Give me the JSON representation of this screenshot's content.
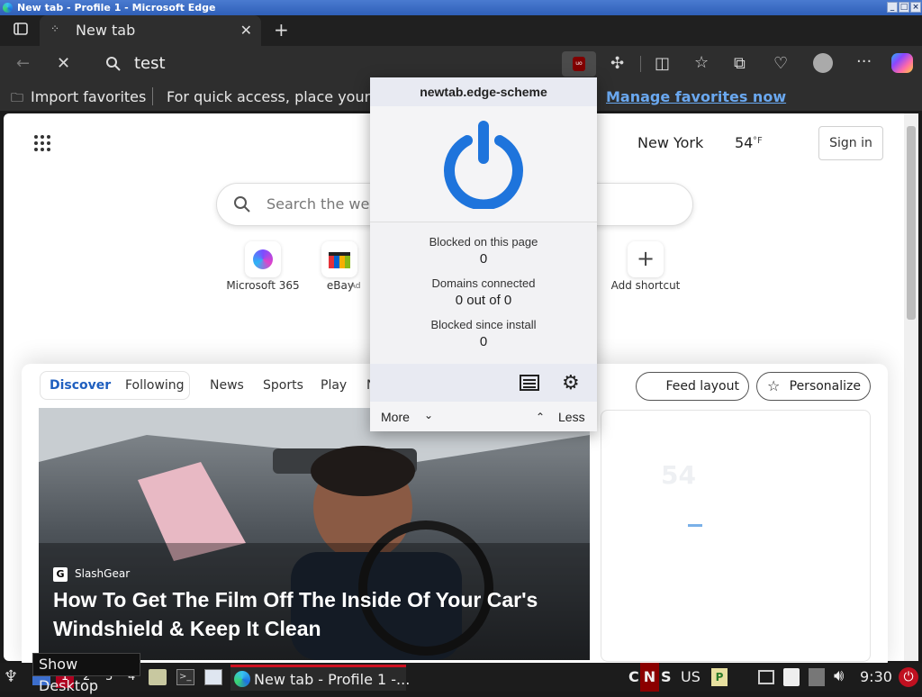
{
  "window": {
    "title": "New tab - Profile 1 - Microsoft Edge"
  },
  "tab": {
    "title": "New tab"
  },
  "address_bar": {
    "value": "test"
  },
  "favorites_bar": {
    "import_label": "Import favorites",
    "hint": "For quick access, place your fa",
    "manage_link": "Manage favorites now"
  },
  "newtab": {
    "weather": {
      "city": "New York",
      "temp": "54",
      "unit": "°F"
    },
    "sign_in": "Sign in",
    "search_placeholder": "Search the web",
    "shortcuts": [
      {
        "label": "Microsoft 365"
      },
      {
        "label": "eBay",
        "badge": "· Ad"
      },
      {
        "label": "Add shortcut"
      }
    ],
    "feed_tabs": {
      "discover": "Discover",
      "following": "Following"
    },
    "feed_nav": [
      "News",
      "Sports",
      "Play",
      "N"
    ],
    "feed_layout": "Feed layout",
    "personalize": "Personalize",
    "article": {
      "source": "SlashGear",
      "headline": "How To Get The Film Off The Inside Of Your Car's Windshield & Keep It Clean"
    },
    "side_card": {
      "temp": "54"
    }
  },
  "ublock": {
    "hostname": "newtab.edge-scheme",
    "stats": [
      {
        "label": "Blocked on this page",
        "value": "0"
      },
      {
        "label": "Domains connected",
        "value": "0 out of 0"
      },
      {
        "label": "Blocked since install",
        "value": "0"
      }
    ],
    "more": "More",
    "less": "Less",
    "accent": "#1e74dc"
  },
  "taskbar": {
    "tooltip": "Show Desktop",
    "workspaces": [
      "1",
      "2",
      "3",
      "4"
    ],
    "window_button": "New tab - Profile 1 -...",
    "indicators": {
      "c": "C",
      "n": "N",
      "s": "S"
    },
    "layout": "US",
    "time": "9:30"
  }
}
